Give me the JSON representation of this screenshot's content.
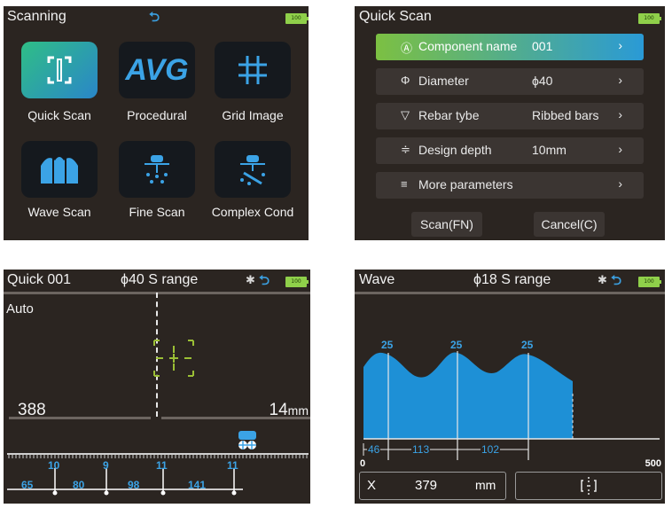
{
  "menu": {
    "title": "Scanning",
    "battery": "100",
    "icons": [
      "scan-frame-icon",
      "avg-icon",
      "grid-icon",
      "wave-icon",
      "fine-scan-icon",
      "complex-cond-icon"
    ],
    "avg_text": "AVG",
    "items": [
      {
        "label": "Quick Scan",
        "selected": true
      },
      {
        "label": "Procedural"
      },
      {
        "label": "Grid Image"
      },
      {
        "label": "Wave Scan"
      },
      {
        "label": "Fine Scan"
      },
      {
        "label": "Complex Cond"
      }
    ]
  },
  "quick_scan": {
    "title": "Quick  Scan",
    "battery": "100",
    "rows": [
      {
        "icon": "Ⓐ",
        "label": "Component name",
        "value": "001",
        "selected": true
      },
      {
        "icon": "Φ",
        "label": "Diameter",
        "value": "ϕ40"
      },
      {
        "icon": "▽",
        "label": "Rebar tybe",
        "value": "Ribbed bars"
      },
      {
        "icon": "≑",
        "label": "Design depth",
        "value": "10mm"
      },
      {
        "icon": "≡",
        "label": "More parameters",
        "value": ""
      }
    ],
    "chevron": "›",
    "scan_button": "Scan(FN)",
    "cancel_button": "Cancel(C)"
  },
  "quick_view": {
    "title": "Quick 001",
    "range": "ϕ40 S range",
    "battery": "100",
    "mode": "Auto",
    "left_value": "388",
    "right_value": "14",
    "right_unit": "mm",
    "ruler_labels": [
      "10",
      "9",
      "11",
      "11"
    ],
    "bottom_labels": [
      "65",
      "80",
      "98",
      "141"
    ]
  },
  "wave_view": {
    "title": "Wave",
    "range": "ϕ18 S  range",
    "battery": "100",
    "peak_labels": [
      "25",
      "25",
      "25"
    ],
    "segment_labels": [
      "46",
      "113",
      "102"
    ],
    "axis_min": "0",
    "axis_max": "500",
    "x_label": "X",
    "x_value": "379",
    "x_unit": "mm"
  },
  "colors": {
    "accent": "#3ba3e6",
    "panel": "#2b2521",
    "selected_green": "#7cc042"
  }
}
